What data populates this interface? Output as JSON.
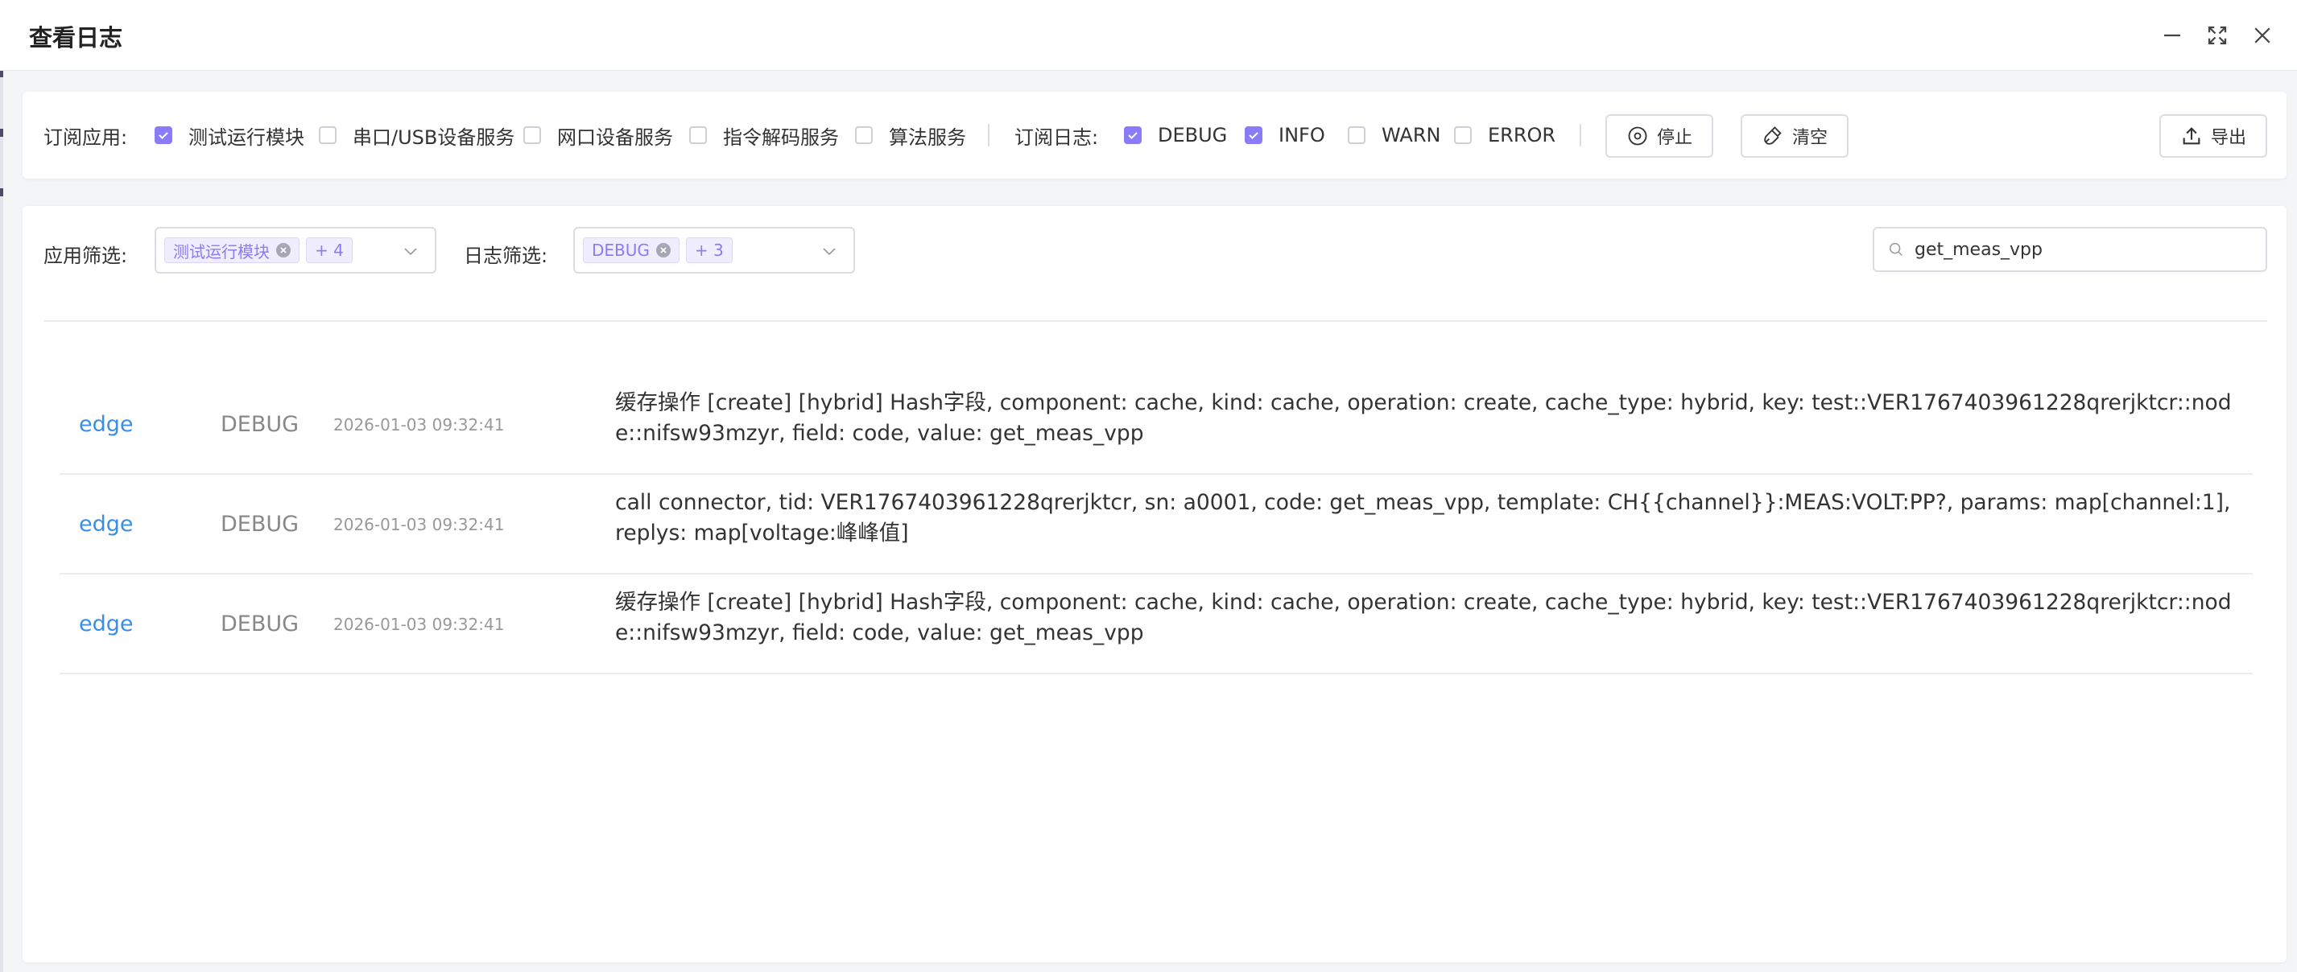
{
  "window": {
    "title": "查看日志"
  },
  "subscribe": {
    "app_label": "订阅应用:",
    "apps": [
      {
        "label": "测试运行模块",
        "checked": true
      },
      {
        "label": "串口/USB设备服务",
        "checked": false
      },
      {
        "label": "网口设备服务",
        "checked": false
      },
      {
        "label": "指令解码服务",
        "checked": false
      },
      {
        "label": "算法服务",
        "checked": false
      }
    ],
    "log_label": "订阅日志:",
    "levels": [
      {
        "label": "DEBUG",
        "checked": true
      },
      {
        "label": "INFO",
        "checked": true
      },
      {
        "label": "WARN",
        "checked": false
      },
      {
        "label": "ERROR",
        "checked": false
      }
    ],
    "stop_label": "停止",
    "clear_label": "清空",
    "export_label": "导出"
  },
  "filter": {
    "app_label": "应用筛选:",
    "app_tag": "测试运行模块",
    "app_more": "+ 4",
    "log_label": "日志筛选:",
    "log_tag": "DEBUG",
    "log_more": "+ 3",
    "search_value": "get_meas_vpp"
  },
  "logs": [
    {
      "app": "edge",
      "level": "DEBUG",
      "time": "2026-01-03 09:32:41",
      "message": "缓存操作 [create] [hybrid] Hash字段, component: cache, kind: cache, operation: create, cache_type: hybrid, key: test::VER1767403961228qrerjktcr::node::nifsw93mzyr, field: code, value: get_meas_vpp"
    },
    {
      "app": "edge",
      "level": "DEBUG",
      "time": "2026-01-03 09:32:41",
      "message": "call connector, tid: VER1767403961228qrerjktcr, sn: a0001, code: get_meas_vpp, template: CH{{channel}}:MEAS:VOLT:PP?, params: map[channel:1], replys: map[voltage:峰峰值]"
    },
    {
      "app": "edge",
      "level": "DEBUG",
      "time": "2026-01-03 09:32:41",
      "message": "缓存操作 [create] [hybrid] Hash字段, component: cache, kind: cache, operation: create, cache_type: hybrid, key: test::VER1767403961228qrerjktcr::node::nifsw93mzyr, field: code, value: get_meas_vpp"
    }
  ],
  "colors": {
    "accent": "#8a7cf6",
    "link": "#3a8ee6"
  }
}
